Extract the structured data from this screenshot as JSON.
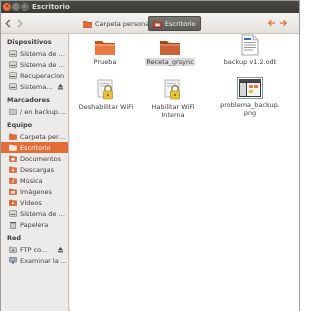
{
  "window": {
    "title": "Escritorio",
    "close_glyph": "×",
    "minimize_glyph": "–",
    "maximize_glyph": "□"
  },
  "toolbar": {
    "breadcrumbs": [
      {
        "label": "Carpeta personal",
        "icon": "home-folder-icon"
      },
      {
        "label": "Escritorio",
        "icon": "desktop-folder-icon",
        "active": true
      }
    ],
    "accent": "#e26d38"
  },
  "sidebar": {
    "sections": [
      {
        "title": "Dispositivos",
        "items": [
          {
            "label": "Sistema de a...",
            "icon": "drive-icon"
          },
          {
            "label": "Sistema de a...",
            "icon": "drive-icon"
          },
          {
            "label": "Recuperacion",
            "icon": "drive-icon"
          },
          {
            "label": "Sistema...",
            "icon": "drive-icon",
            "eject": true
          }
        ]
      },
      {
        "title": "Marcadores",
        "items": [
          {
            "label": "/ en backup....",
            "icon": "bookmark-folder-icon"
          }
        ]
      },
      {
        "title": "Equipo",
        "items": [
          {
            "label": "Carpeta perso...",
            "icon": "home-folder-icon"
          },
          {
            "label": "Escritorio",
            "icon": "desktop-folder-icon",
            "active": true
          },
          {
            "label": "Documentos",
            "icon": "documents-folder-icon"
          },
          {
            "label": "Descargas",
            "icon": "downloads-folder-icon"
          },
          {
            "label": "Música",
            "icon": "music-folder-icon"
          },
          {
            "label": "Imágenes",
            "icon": "pictures-folder-icon"
          },
          {
            "label": "Vídeos",
            "icon": "videos-folder-icon"
          },
          {
            "label": "Sistema de a...",
            "icon": "drive-icon"
          },
          {
            "label": "Papelera",
            "icon": "trash-icon"
          }
        ]
      },
      {
        "title": "Red",
        "items": [
          {
            "label": "FTP co...",
            "icon": "network-folder-icon",
            "eject": true
          },
          {
            "label": "Examinar la ...",
            "icon": "network-icon"
          }
        ]
      }
    ]
  },
  "files": [
    {
      "label": "Prueba",
      "icon": "folder-icon"
    },
    {
      "label": "Receta_grsync",
      "icon": "folder-icon",
      "selected": true
    },
    {
      "label": "backup v1.2.odt",
      "icon": "document-icon"
    },
    {
      "label": "Deshabilitar WiFi",
      "icon": "script-lock-icon"
    },
    {
      "label": "Habilitar WiFi\nInterna",
      "icon": "script-lock-icon"
    },
    {
      "label": "problema_backup.\npng",
      "icon": "image-icon"
    }
  ]
}
